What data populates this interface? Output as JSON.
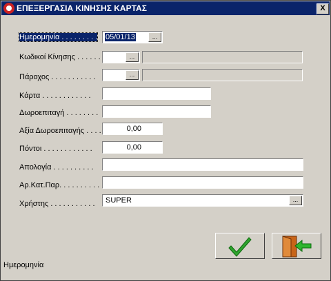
{
  "window": {
    "title": "ΕΠΕΞΕΡΓΑΣΙΑ ΚΙΝΗΣΗΣ ΚΑΡΤΑΣ",
    "close_label": "X"
  },
  "form": {
    "date_label": "Ημερομηνία . . . . . . . . .",
    "date_value": "05/01/13",
    "codes_label": "Κωδικοί Κίνησης . . . . . . .",
    "provider_label": "Πάροχος . . . . . . . . . . .",
    "card_label": "Κάρτα . . . . . . . . . . . .",
    "gift_label": "Δωροεπιταγή . . . . . . . .",
    "gift_value_label": "Αξία Δωροεπιταγής . . . .",
    "gift_value": "0,00",
    "points_label": "Πόντοι . . . . . . . . . . . .",
    "points_value": "0,00",
    "reason_label": "Απολογία . . . . . . . . . .",
    "doc_label": "Αρ.Κατ.Παρ. . . . . . . . . .",
    "user_label": "Χρήστης . . . . . . . . . . .",
    "user_value": "SUPER",
    "dots_button": "..."
  },
  "status_text": "Ημερομηνία",
  "icons": {
    "ok": "check-icon",
    "exit": "exit-door-icon"
  }
}
